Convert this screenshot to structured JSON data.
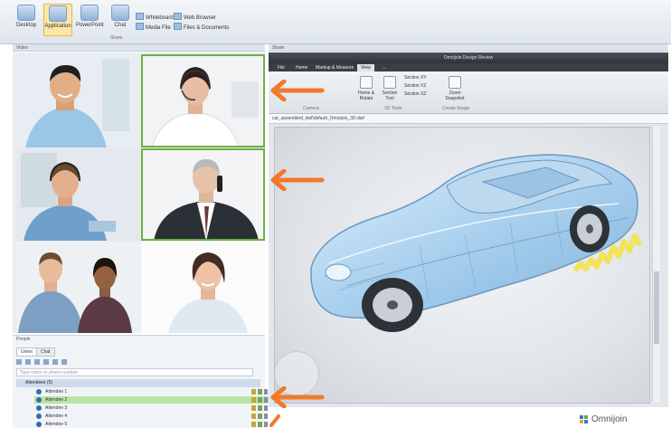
{
  "ribbon": {
    "buttons": [
      {
        "label": "Desktop"
      },
      {
        "label": "Application"
      },
      {
        "label": "PowerPoint"
      },
      {
        "label": "Chat"
      }
    ],
    "small_items": [
      {
        "label": "Whiteboard"
      },
      {
        "label": "Web Browser"
      },
      {
        "label": "Media File"
      },
      {
        "label": "Files & Documents"
      }
    ],
    "group_label": "Share"
  },
  "video_panel": {
    "title": "Video"
  },
  "share_panel": {
    "title": "Share"
  },
  "shared_app": {
    "title": "Omnijoin Design Review",
    "tabs": [
      "File",
      "Home",
      "Markup & Measure",
      "View",
      "..."
    ],
    "active_tab": 3,
    "ribbon_buttons": [
      "Home & Rotate",
      "Section Tool",
      "Zoom Snapshot"
    ],
    "ribbon_small": [
      "Section XY",
      "Section YZ",
      "Section XZ"
    ],
    "ribbon_groups": [
      "Camera",
      "3D Tools",
      "Create Image"
    ],
    "address": "car_assembled_dwf\\default_Omnijoin_3D.dwf"
  },
  "sidebar": {
    "title": "People",
    "tabs": [
      "Users",
      "Chat"
    ],
    "search_placeholder": "Type name or phone number",
    "group": "Attendees (5)",
    "attendees": [
      "Attendee 1",
      "Attendee 2",
      "Attendee 3",
      "Attendee 4",
      "Attendee 5"
    ],
    "selected_index": 1
  },
  "brand": {
    "name": "Omnijoin"
  },
  "colors": {
    "highlight": "#6fae45",
    "arrow": "#f07a2a",
    "scribble": "#f2e35a"
  }
}
